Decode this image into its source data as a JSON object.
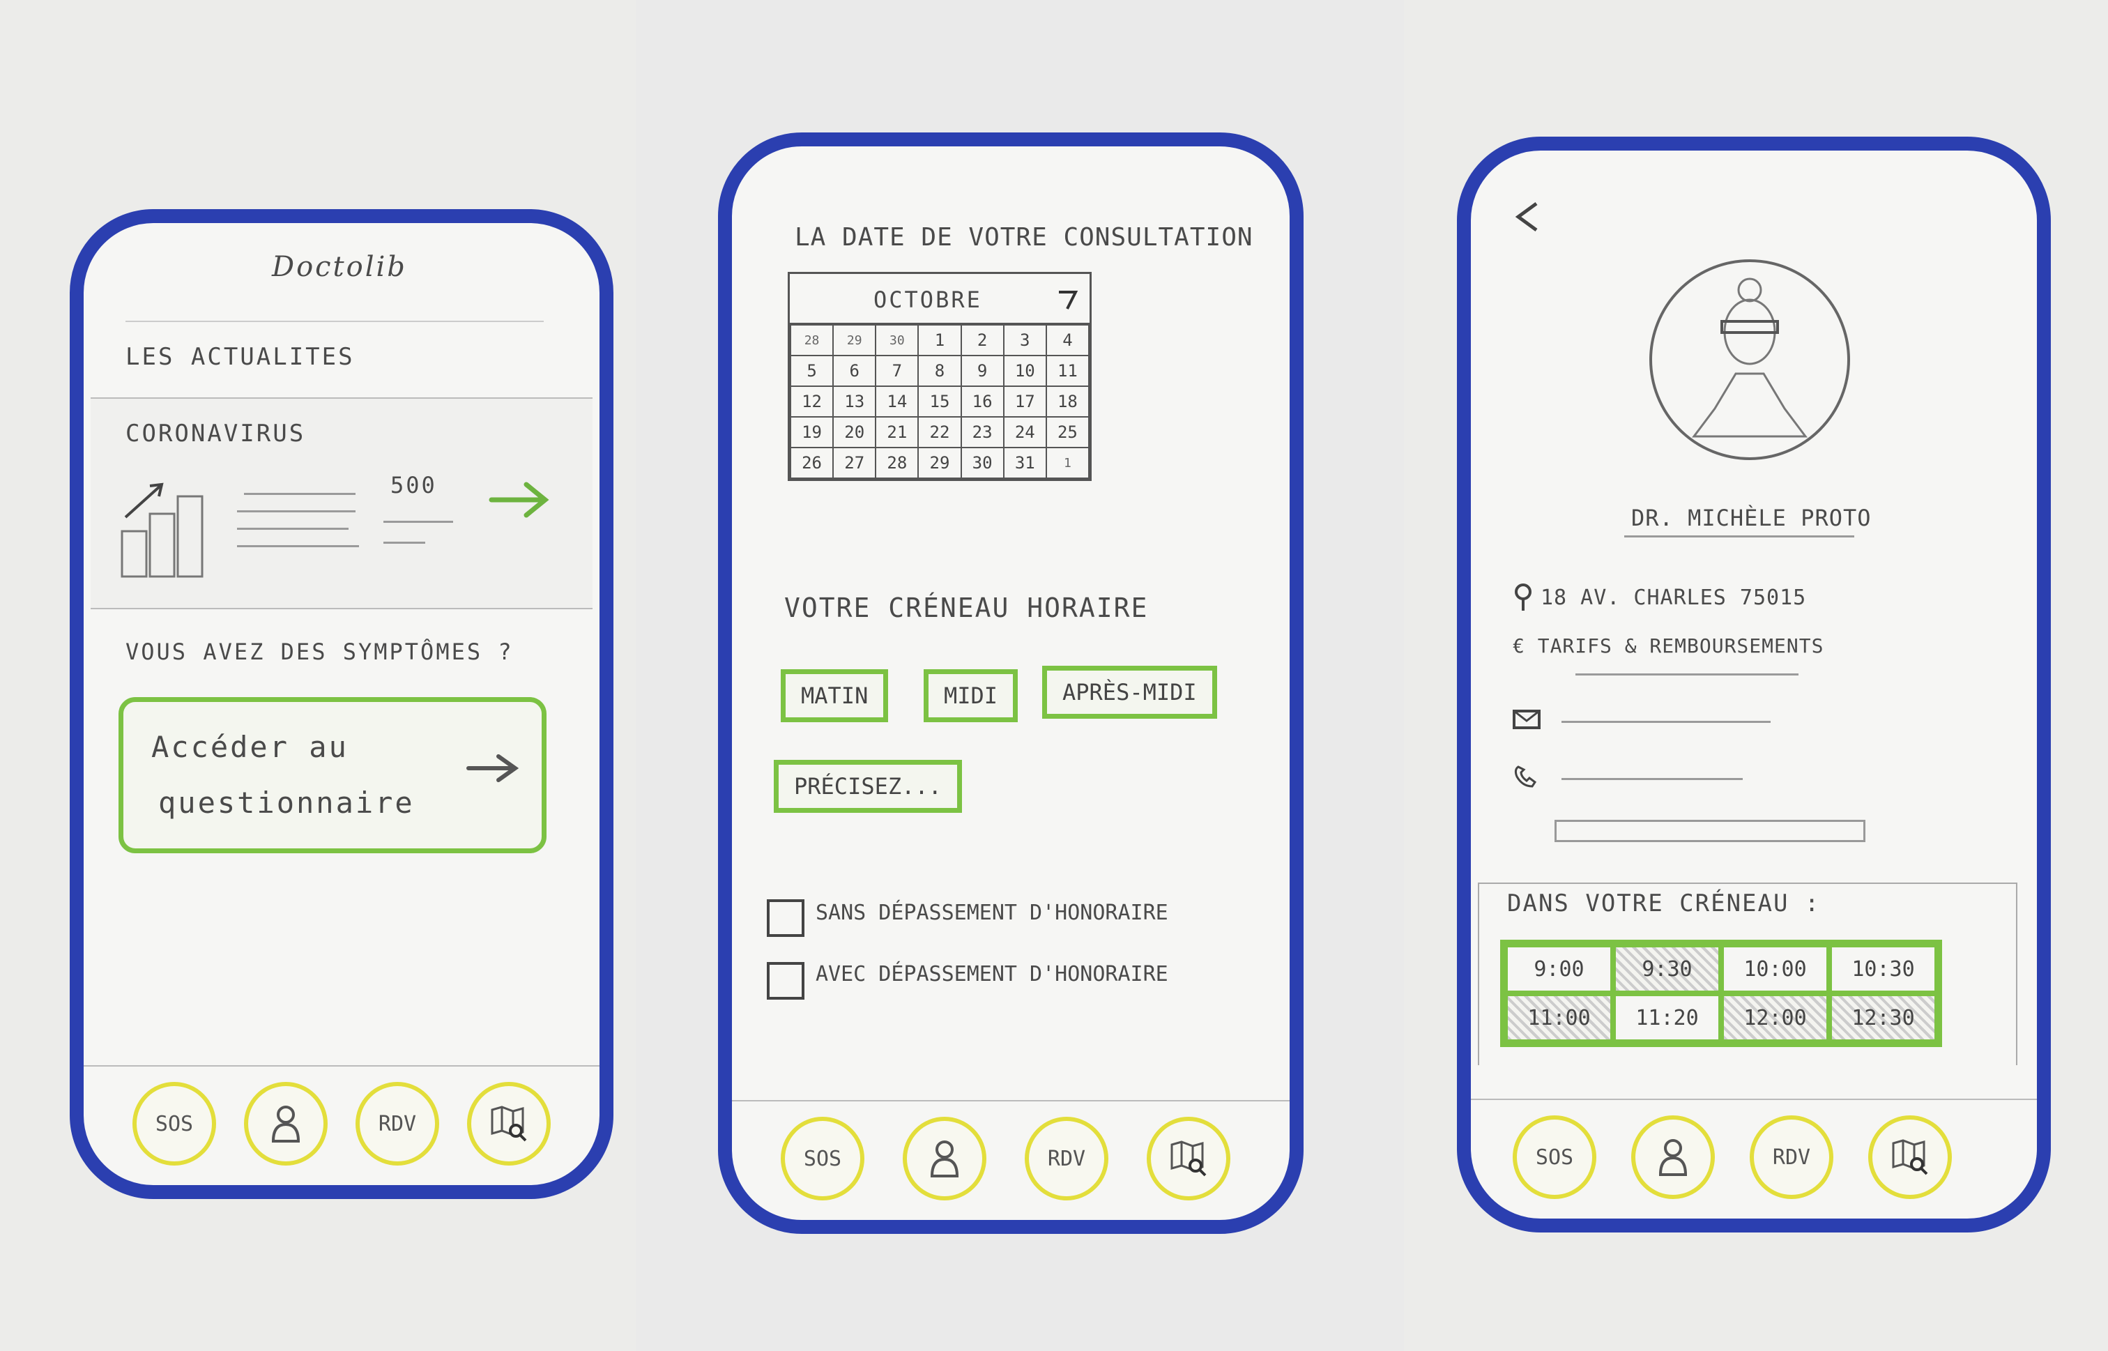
{
  "screen1": {
    "title": "Doctolib",
    "news_heading": "LES ACTUALITES",
    "news_card": {
      "title": "CORONAVIRUS",
      "count": "500"
    },
    "symptoms_question": "VOUS AVEZ DES SYMPTÔMES ?",
    "questionnaire_button": {
      "line1": "Accéder au",
      "line2": "questionnaire"
    }
  },
  "screen2": {
    "heading": "LA DATE DE VOTRE CONSULTATION",
    "calendar": {
      "month": "OCTOBRE",
      "rows": [
        [
          "28",
          "29",
          "30",
          "1",
          "2",
          "3",
          "4"
        ],
        [
          "5",
          "6",
          "7",
          "8",
          "9",
          "10",
          "11"
        ],
        [
          "12",
          "13",
          "14",
          "15",
          "16",
          "17",
          "18"
        ],
        [
          "19",
          "20",
          "21",
          "22",
          "23",
          "24",
          "25"
        ],
        [
          "26",
          "27",
          "28",
          "29",
          "30",
          "31",
          "1"
        ]
      ]
    },
    "slot_heading": "VOTRE CRÉNEAU HORAIRE",
    "slots": {
      "matin": "MATIN",
      "midi": "MIDI",
      "apres_midi": "APRÈS-MIDI",
      "precisez": "PRÉCISEZ..."
    },
    "options": {
      "sans": "SANS DÉPASSEMENT D'HONORAIRE",
      "avec": "AVEC DÉPASSEMENT D'HONORAIRE"
    }
  },
  "screen3": {
    "doctor_name": "DR. MICHÈLE PROTO",
    "address": "18 AV. CHARLES 75015",
    "tarifs": "€ TARIFS & REMBOURSEMENTS",
    "slots_heading": "DANS VOTRE CRÉNEAU :",
    "times": [
      {
        "label": "9:00",
        "busy": false
      },
      {
        "label": "9:30",
        "busy": true
      },
      {
        "label": "10:00",
        "busy": false
      },
      {
        "label": "10:30",
        "busy": false
      },
      {
        "label": "11:00",
        "busy": true
      },
      {
        "label": "11:20",
        "busy": false
      },
      {
        "label": "12:00",
        "busy": true
      },
      {
        "label": "12:30",
        "busy": true
      }
    ]
  },
  "nav": {
    "sos": "SOS",
    "rdv": "RDV"
  },
  "colors": {
    "frame": "#2b3fb0",
    "accent_green": "#7cc243",
    "nav_yellow": "#e3de3b"
  },
  "icons": [
    "arrow-right-icon",
    "chart-icon",
    "person-icon",
    "map-search-icon",
    "back-arrow-icon",
    "location-pin-icon",
    "mail-icon",
    "phone-icon",
    "doctor-portrait"
  ]
}
